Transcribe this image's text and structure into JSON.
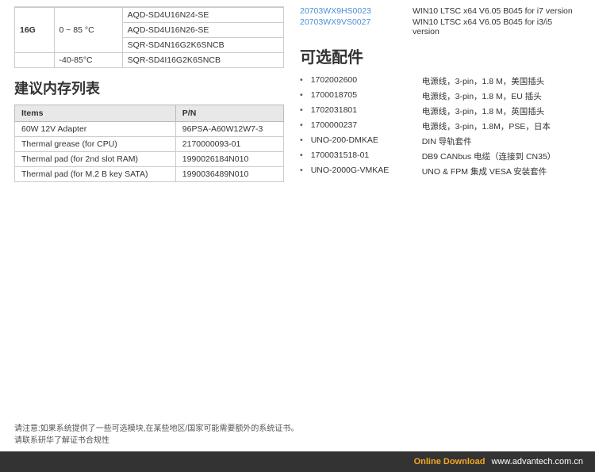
{
  "top_table": {
    "rows": [
      {
        "model_label": "16G",
        "temp": "0 ~ 85 °C",
        "models": [
          "AQD-SD4U16N24-SE",
          "AQD-SD4U16N26-SE",
          "SQR-SD4N16G2K6SNCB"
        ]
      },
      {
        "model_label": "",
        "temp": "-40-85°C",
        "models": [
          "SQR-SD4I16G2K6SNCB"
        ]
      }
    ]
  },
  "top_right": {
    "rows": [
      {
        "part": "20703WX9HS0023",
        "desc": "WIN10 LTSC x64 V6.05 B045 for i7 version"
      },
      {
        "part": "20703WX9VS0027",
        "desc": "WIN10 LTSC x64 V6.05 B045 for i3/i5 version"
      }
    ]
  },
  "optional_heading": "可选配件",
  "optional_items": [
    {
      "part": "1702002600",
      "desc": "电源线，3-pin，1.8 M，美国插头"
    },
    {
      "part": "1700018705",
      "desc": "电源线，3-pin，1.8 M，EU 插头"
    },
    {
      "part": "1702031801",
      "desc": "电源线，3-pin，1.8 M，英国插头"
    },
    {
      "part": "1700000237",
      "desc": "电源线，3-pin，1.8M，PSE，日本"
    },
    {
      "part": "UNO-200-DMKAE",
      "desc": "DIN 导轨套件"
    },
    {
      "part": "1700031518-01",
      "desc": "DB9 CANbus 电缆（连接到 CN35）"
    },
    {
      "part": "UNO-2000G-VMKAE",
      "desc": "UNO & FPM 集成 VESA 安装套件"
    }
  ],
  "memory_section": {
    "heading": "建议内存列表",
    "columns": [
      "Items",
      "P/N"
    ],
    "rows": [
      {
        "item": "60W 12V Adapter",
        "pn": "96PSA-A60W12W7-3"
      },
      {
        "item": "Thermal grease (for CPU)",
        "pn": "2170000093-01"
      },
      {
        "item": "Thermal pad (for 2nd slot RAM)",
        "pn": "1990026184N010"
      },
      {
        "item": "Thermal pad (for M.2 B key SATA)",
        "pn": "1990036489N010"
      }
    ]
  },
  "footer": {
    "note_line1": "请注意:如果系统提供了一些可选模块,在某些地区/国家可能需要额外的系统证书。",
    "note_line2": "请联系研华了解证书合规性",
    "online_label": "Online Download",
    "website": "www.advantech.com.cn"
  }
}
